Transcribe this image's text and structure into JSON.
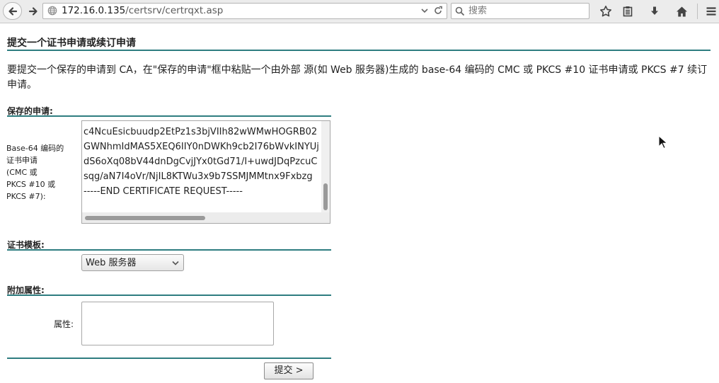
{
  "browser": {
    "url_host": "172.16.0.135",
    "url_path": "/certsrv/certrqxt.asp",
    "search_placeholder": "搜索"
  },
  "page": {
    "title": "提交一个证书申请或续订申请",
    "intro": "要提交一个保存的申请到 CA，在\"保存的申请\"框中粘贴一个由外部 源(如 Web 服务器)生成的 base-64 编码的 CMC 或 PKCS #10 证书申请或 PKCS #7 续订申请。",
    "saved_request": {
      "section_title": "保存的申请:",
      "field_label": "Base-64 编码的\n证书申请\n(CMC 或\nPKCS #10 或\nPKCS #7):",
      "lines": [
        "c4NcuEsicbuudp2EtPz1s3bjVIIh82wWMwHOGRB02",
        "GWNhmIdMAS5XEQ6IIY0nDWKh9cb2I76bWvkINYUj",
        "dS6oXq08bV44dnDgCvjJYx0tGd71/I+uwdJDqPzcuC",
        "sqg/aN7I4oVr/NjIL8KTWu3x9b7SSMJMMtnx9Fxbzg",
        "-----END CERTIFICATE REQUEST-----"
      ]
    },
    "template": {
      "section_title": "证书模板:",
      "selected": "Web 服务器"
    },
    "attributes": {
      "section_title": "附加属性:",
      "label": "属性:"
    },
    "submit_label": "提交 >"
  },
  "colors": {
    "accent_rule": "#2e7d80"
  }
}
